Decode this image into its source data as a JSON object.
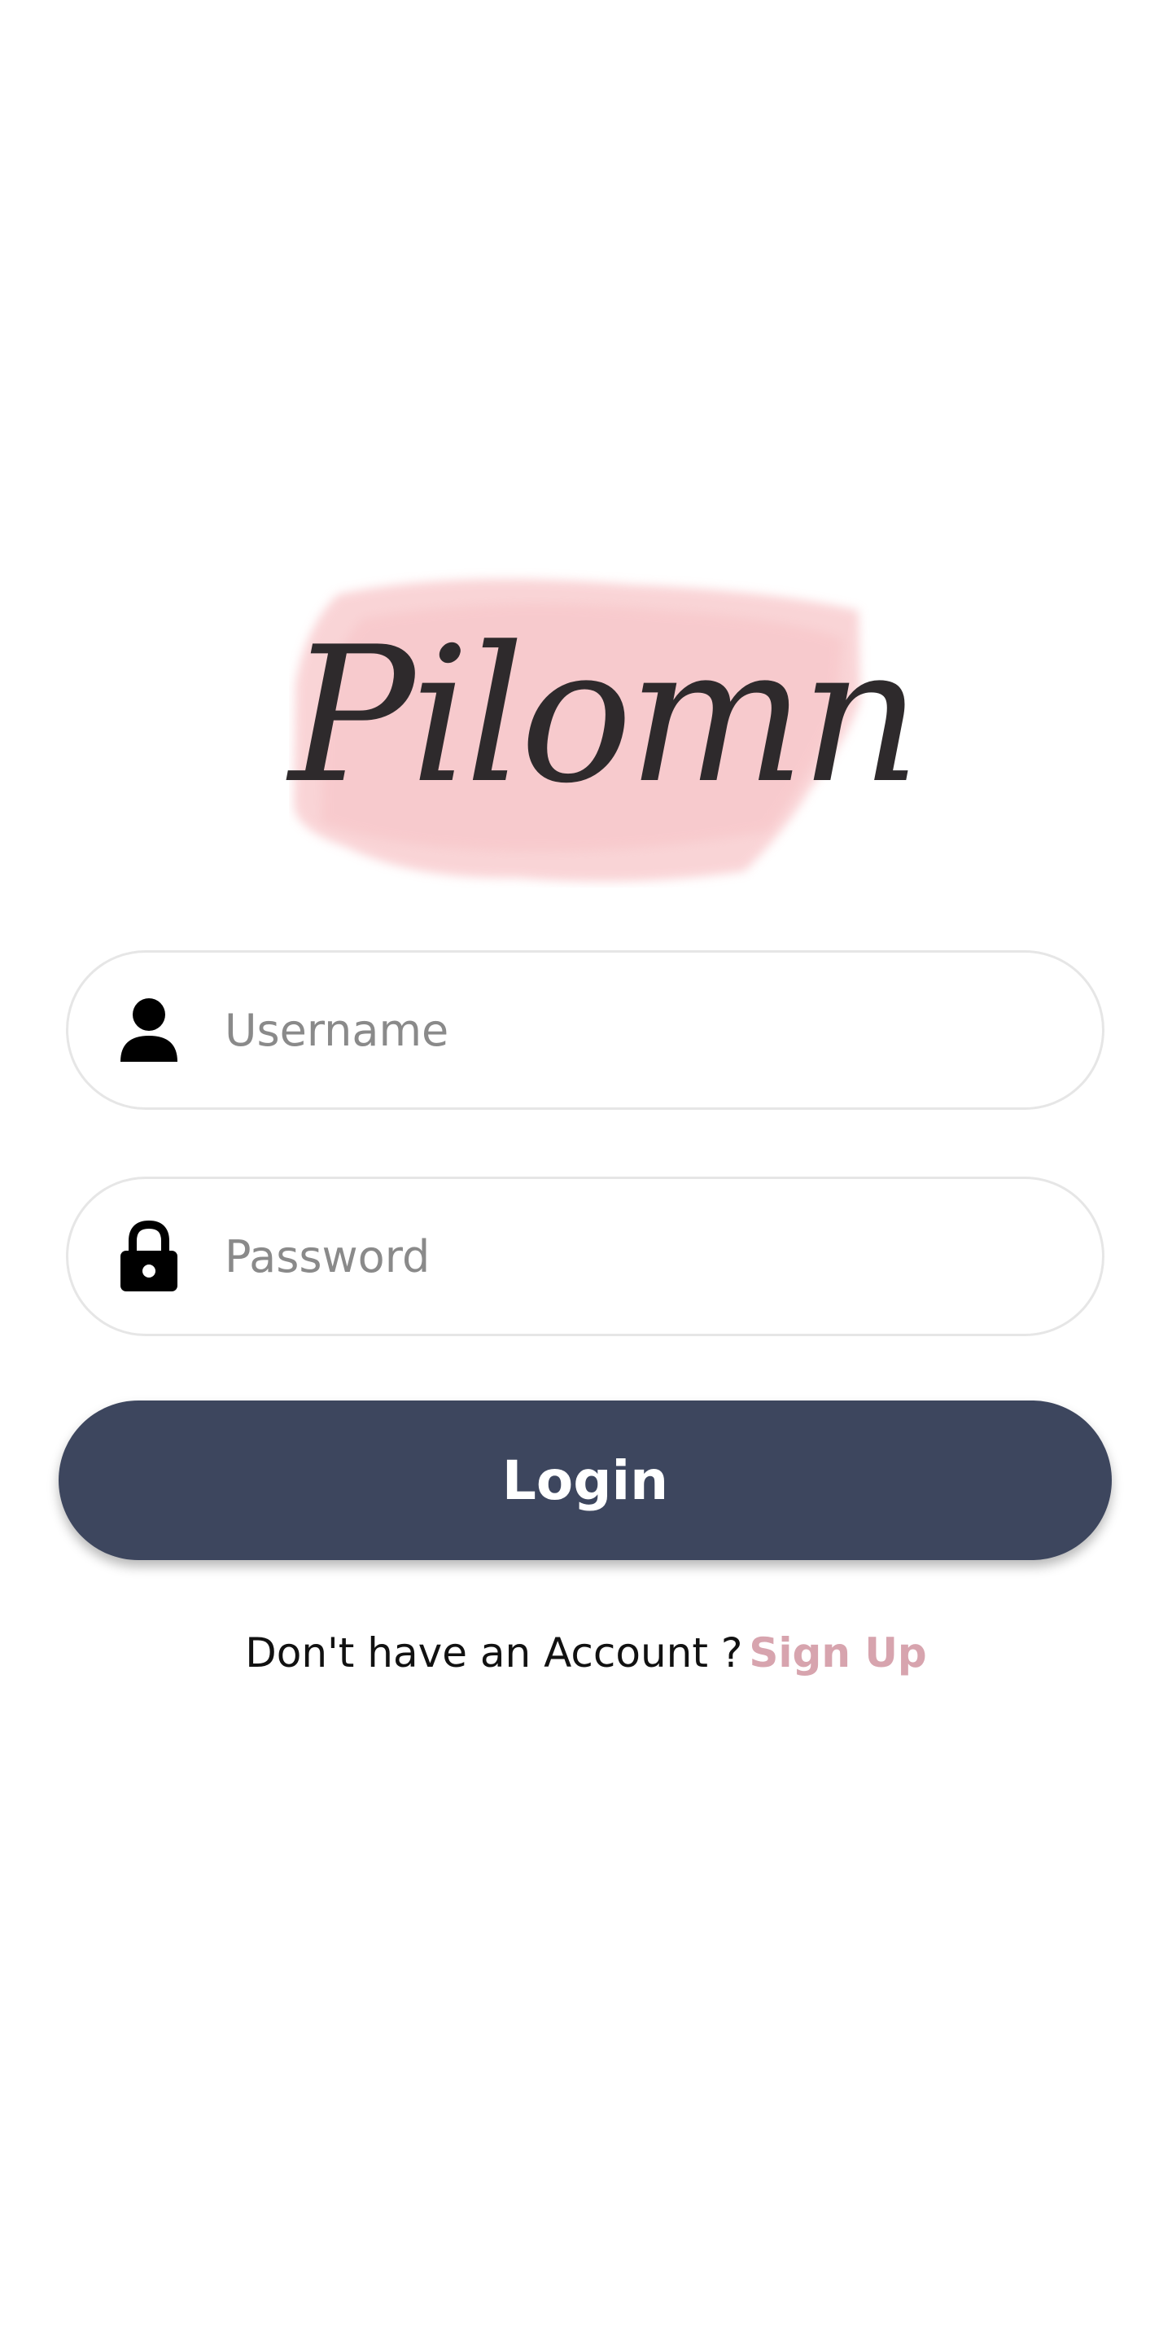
{
  "logo": {
    "text": "Pilomn",
    "text_color": "#2e2a2c",
    "brush_color": "#f8c6c9"
  },
  "form": {
    "username": {
      "icon": "person-icon",
      "placeholder": "Username",
      "value": ""
    },
    "password": {
      "icon": "lock-icon",
      "placeholder": "Password",
      "value": ""
    },
    "login_label": "Login",
    "login_color": "#3d465e"
  },
  "signup": {
    "prompt": "Don't have an Account ?",
    "link_label": "Sign Up",
    "link_color": "#d7a4ae"
  }
}
